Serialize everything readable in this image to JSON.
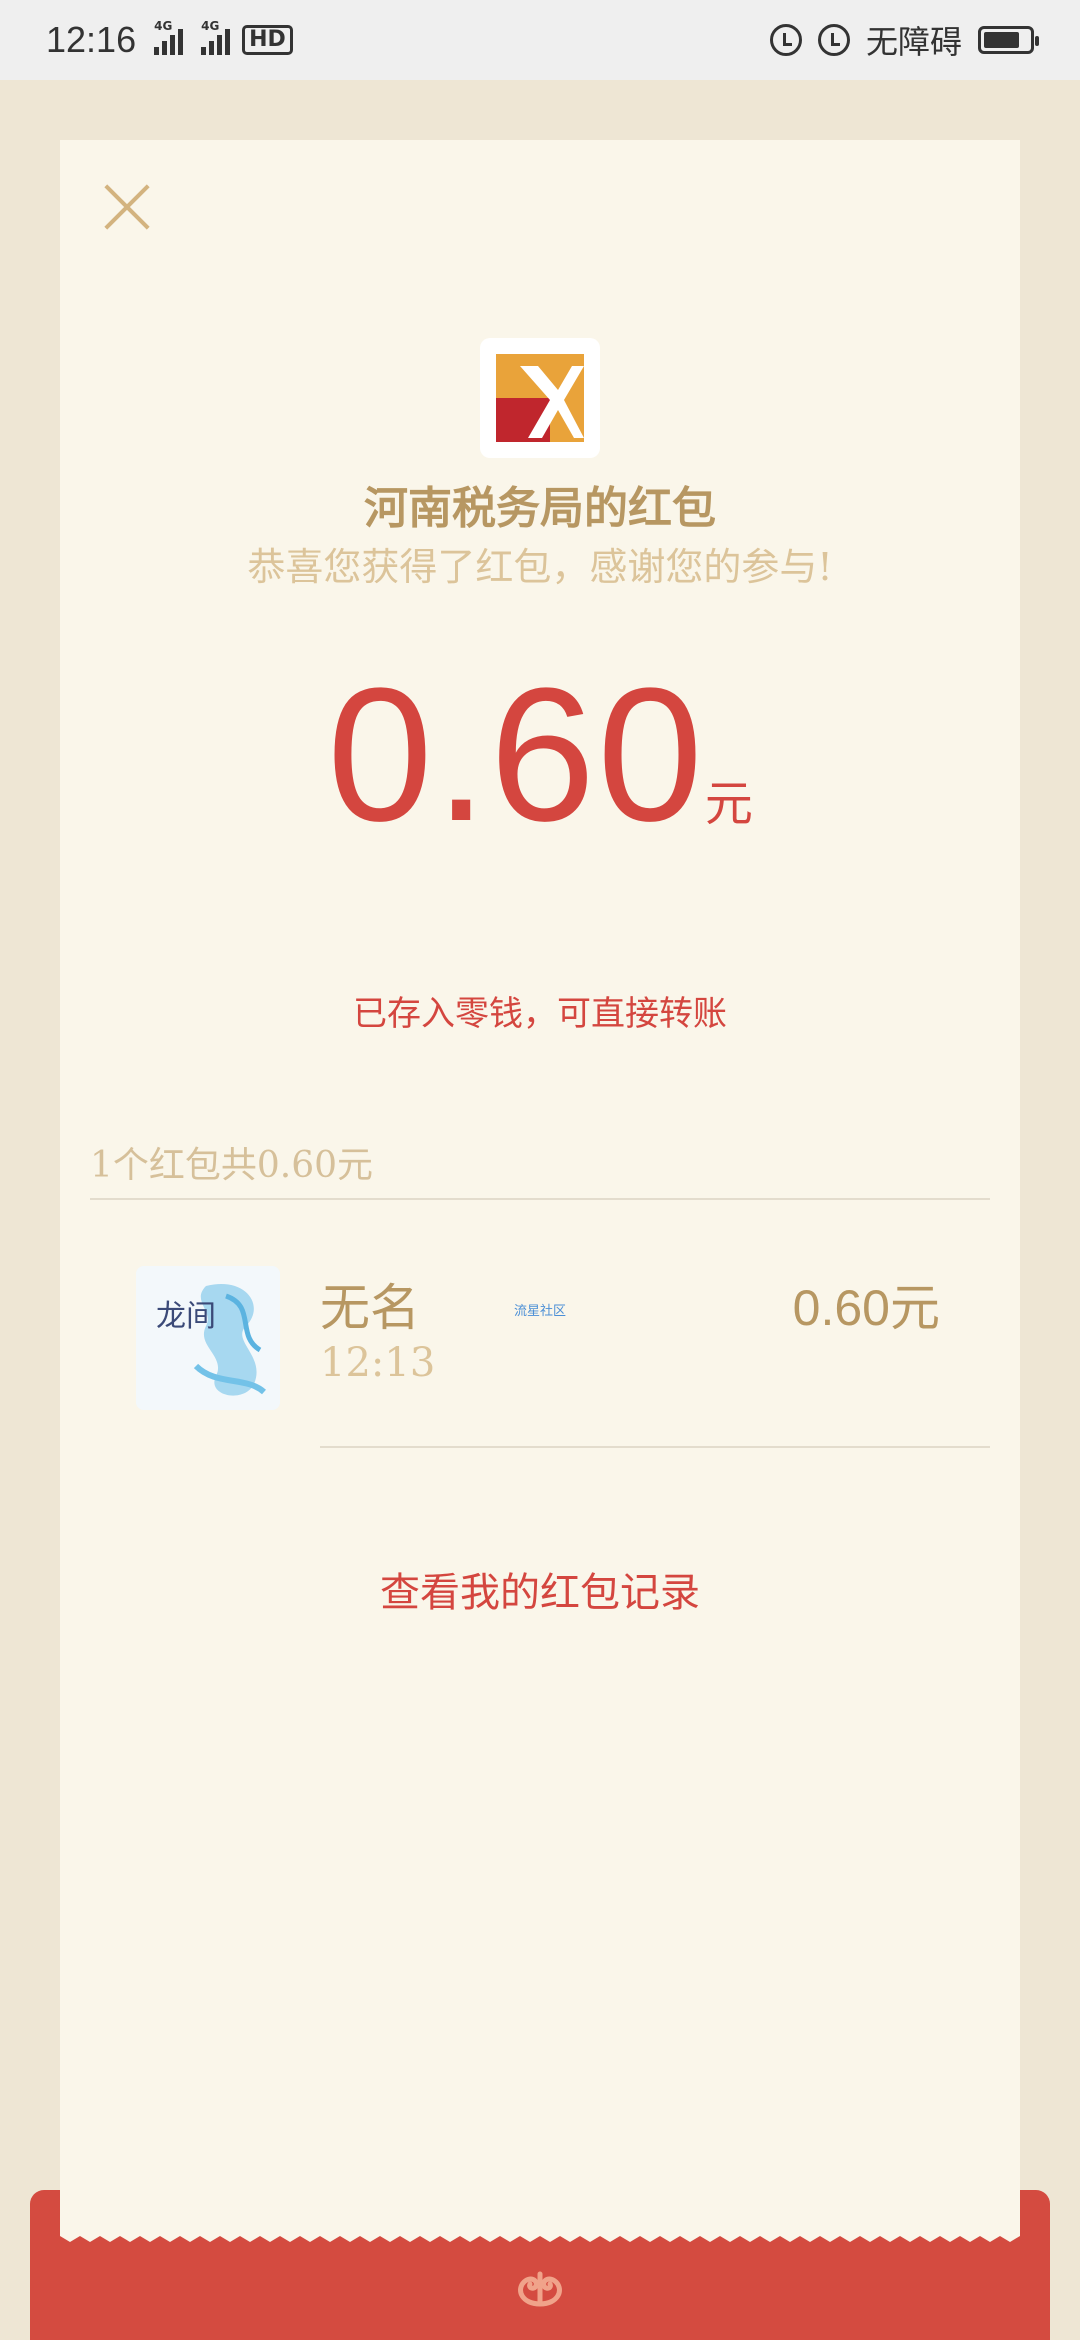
{
  "status_bar": {
    "time": "12:16",
    "signal1_label": "4G",
    "signal2_label": "4G",
    "hd_label": "HD",
    "accessibility_label": "无障碍"
  },
  "card": {
    "title": "河南税务局的红包",
    "subtitle": "恭喜您获得了红包，感谢您的参与!",
    "amount": "0.60",
    "amount_unit": "元",
    "saved_note": "已存入零钱，可直接转账",
    "summary": "1个红包共0.60元"
  },
  "record": {
    "name": "无名",
    "time": "12:13",
    "watermark": "流星社区",
    "amount": "0.60元",
    "avatar_text": "龙间"
  },
  "links": {
    "view_records": "查看我的红包记录"
  },
  "colors": {
    "accent_red": "#d4463f",
    "gold": "#b79762",
    "light_gold": "#dcc49a",
    "card_bg": "#faf6ea",
    "page_bg": "#eee6d4"
  },
  "icons": [
    "close-icon",
    "alarm-icon",
    "rotation-lock-icon",
    "battery-icon",
    "swirl-icon"
  ]
}
